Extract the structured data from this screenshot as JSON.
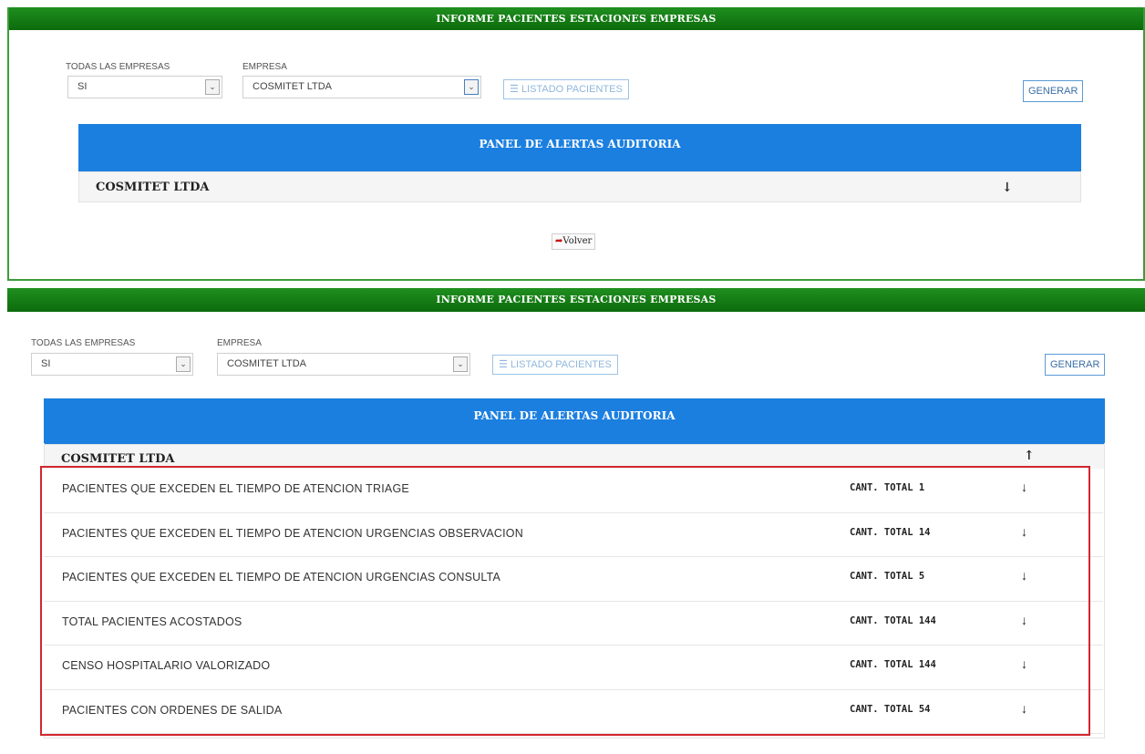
{
  "report_title": "INFORME PACIENTES ESTACIONES EMPRESAS",
  "filters": {
    "todas_label": "TODAS LAS EMPRESAS",
    "todas_value": "SI",
    "empresa_label": "EMPRESA",
    "empresa_value": "COSMITET LTDA",
    "listado_label": "LISTADO PACIENTES",
    "generar_label": "GENERAR"
  },
  "panel": {
    "title": "PANEL DE ALERTAS AUDITORIA",
    "company": "COSMITET LTDA"
  },
  "volver_label": "Volver",
  "arrows": {
    "down": "↓",
    "up": "↑",
    "caret": "⌄",
    "list": "☰"
  },
  "alerts": [
    {
      "label": "PACIENTES QUE EXCEDEN EL TIEMPO DE ATENCION TRIAGE",
      "count": "CANT. TOTAL 1"
    },
    {
      "label": "PACIENTES QUE EXCEDEN EL TIEMPO DE ATENCION URGENCIAS OBSERVACION",
      "count": "CANT. TOTAL 14"
    },
    {
      "label": "PACIENTES QUE EXCEDEN EL TIEMPO DE ATENCION URGENCIAS CONSULTA",
      "count": "CANT. TOTAL 5"
    },
    {
      "label": "TOTAL PACIENTES ACOSTADOS",
      "count": "CANT. TOTAL 144"
    },
    {
      "label": "CENSO HOSPITALARIO VALORIZADO",
      "count": "CANT. TOTAL 144"
    },
    {
      "label": "PACIENTES CON ORDENES DE SALIDA",
      "count": "CANT. TOTAL 54"
    }
  ]
}
